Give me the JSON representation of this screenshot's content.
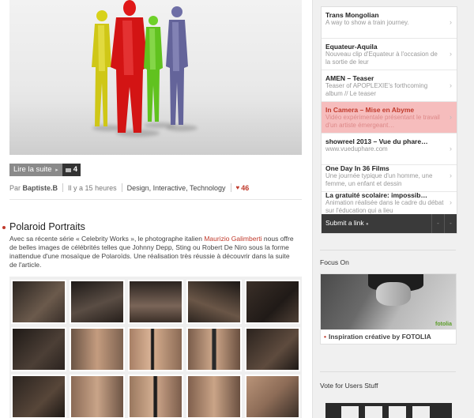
{
  "post_top": {
    "read_more": "Lire la suite",
    "comments_count": "4",
    "meta": {
      "prefix": "Par",
      "author": "Baptiste.B",
      "time": "Il y a 15 heures",
      "tags": "Design, Interactive, Technology",
      "likes": "46"
    }
  },
  "post2": {
    "title": "Polaroid Portraits",
    "desc_before": "Avec sa récente série « Celebrity Works », le photographe italien ",
    "desc_link": "Maurizio Galimberti",
    "desc_after": " nous offre de belles images de célébrités telles que Johnny Depp, Sting ou Robert De Niro sous la forme inattendue d'une mosaïque de Polaroïds. Une réalisation très réussie à découvrir dans la suite de l'article."
  },
  "sidebar": {
    "feed": [
      {
        "title": "Trans Mongolian",
        "desc": "A way to show a train journey."
      },
      {
        "title": "Equateur-Aquila",
        "desc": "Nouveau clip d'Equateur à l'occasion de la sortie de leur"
      },
      {
        "title": "AMEN – Teaser",
        "desc": "Teaser of APOPLEXIE's forthcoming album // Le teaser"
      },
      {
        "title": "In Camera – Mise en Abyme",
        "desc": "Vidéo expérimentale présentant le travail d'un artiste émergeant…"
      },
      {
        "title": "showreel 2013 – Vue du phare…",
        "desc": "www.vueduphare.com"
      },
      {
        "title": "One Day In 36 Films",
        "desc": "Une journée typique d'un homme, une femme, un enfant et dessin"
      },
      {
        "title": "La gratuité scolaire: impossib…",
        "desc": "Animation réalisée dans le cadre du débat sur l'éducation qui a lieu"
      }
    ],
    "submit_label": "Submit a link",
    "submit_ctrl_1": "-",
    "submit_ctrl_2": "-",
    "focus_heading": "Focus On",
    "focus_caption": "Inspiration créative by FOTOLIA",
    "fotolia_logo": "fotolia",
    "vote_heading": "Vote for Users Stuff"
  },
  "colors": {
    "accent": "#c0392b",
    "highlight": "#f6bdbd",
    "dark_bar": "#3a3a3a"
  }
}
